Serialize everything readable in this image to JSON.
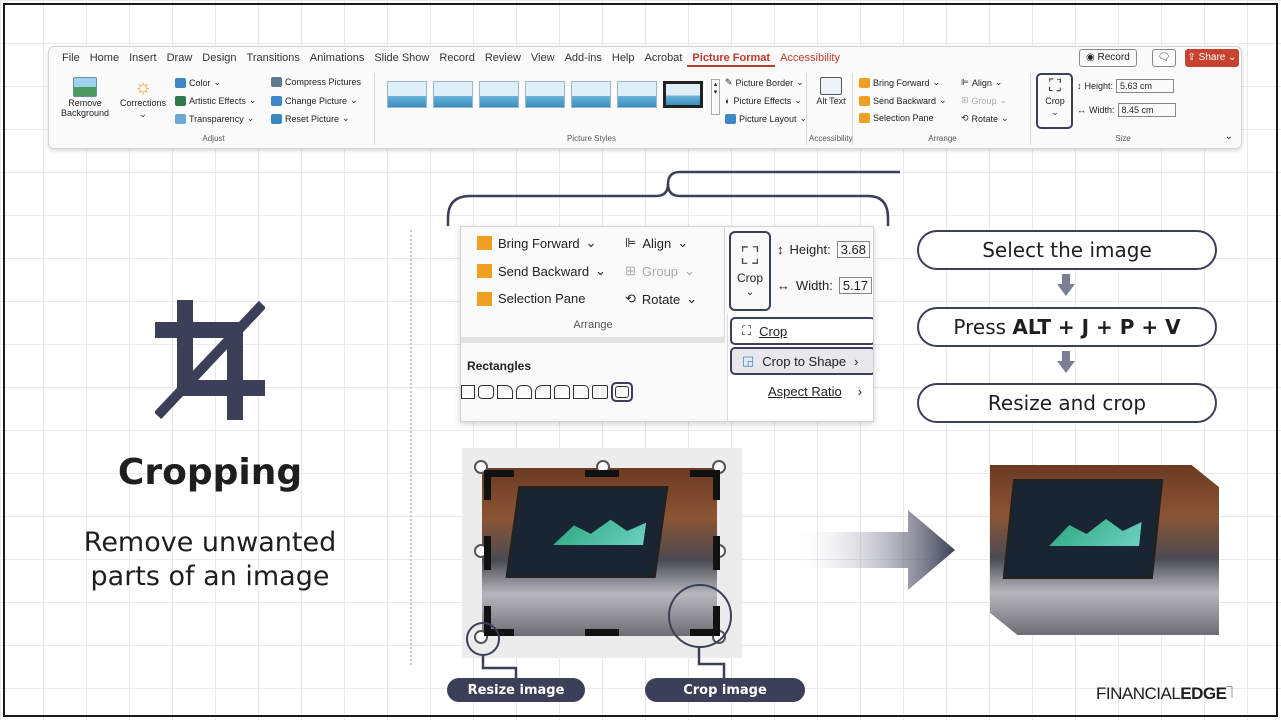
{
  "ribbon": {
    "tabs": [
      "File",
      "Home",
      "Insert",
      "Draw",
      "Design",
      "Transitions",
      "Animations",
      "Slide Show",
      "Record",
      "Review",
      "View",
      "Add-ins",
      "Help",
      "Acrobat",
      "Picture Format",
      "Accessibility"
    ],
    "active_tab": "Picture Format",
    "record_label": "Record",
    "share_label": "Share",
    "adjust": {
      "remove_background": "Remove Background",
      "corrections": "Corrections",
      "color": "Color",
      "artistic_effects": "Artistic Effects",
      "transparency": "Transparency",
      "compress_pictures": "Compress Pictures",
      "change_picture": "Change Picture",
      "reset_picture": "Reset Picture",
      "group_label": "Adjust"
    },
    "picture_styles": {
      "group_label": "Picture Styles",
      "picture_border": "Picture Border",
      "picture_effects": "Picture Effects",
      "picture_layout": "Picture Layout"
    },
    "accessibility": {
      "alt_text": "Alt Text",
      "group_label": "Accessibility"
    },
    "arrange": {
      "bring_forward": "Bring Forward",
      "send_backward": "Send Backward",
      "selection_pane": "Selection Pane",
      "align": "Align",
      "group": "Group",
      "rotate": "Rotate",
      "group_label": "Arrange"
    },
    "size": {
      "crop": "Crop",
      "height_label": "Height:",
      "height_value": "5.63 cm",
      "width_label": "Width:",
      "width_value": "8.45 cm",
      "group_label": "Size"
    }
  },
  "zoom": {
    "bring_forward": "Bring Forward",
    "send_backward": "Send Backward",
    "selection_pane": "Selection Pane",
    "align": "Align",
    "group": "Group",
    "rotate": "Rotate",
    "arrange_label": "Arrange",
    "crop": "Crop",
    "height_label": "Height:",
    "height_value": "3.68",
    "width_label": "Width:",
    "width_value": "5.17",
    "rectangles_label": "Rectangles",
    "menu": {
      "crop": "Crop",
      "crop_to_shape": "Crop to Shape",
      "aspect_ratio": "Aspect Ratio"
    }
  },
  "steps": [
    {
      "text": "Select the image"
    },
    {
      "prefix": "Press ",
      "keys": "ALT + J + P + V"
    },
    {
      "text": "Resize and crop"
    }
  ],
  "left": {
    "title": "Cropping",
    "subtitle_line1": "Remove unwanted",
    "subtitle_line2": "parts of an image"
  },
  "demo": {
    "resize_label": "Resize image",
    "crop_label": "Crop image"
  },
  "brand": {
    "light": "FINANCIAL",
    "bold": "EDGE"
  },
  "colors": {
    "accent_dark": "#3c3f58",
    "ribbon_accent": "#c0392b"
  }
}
